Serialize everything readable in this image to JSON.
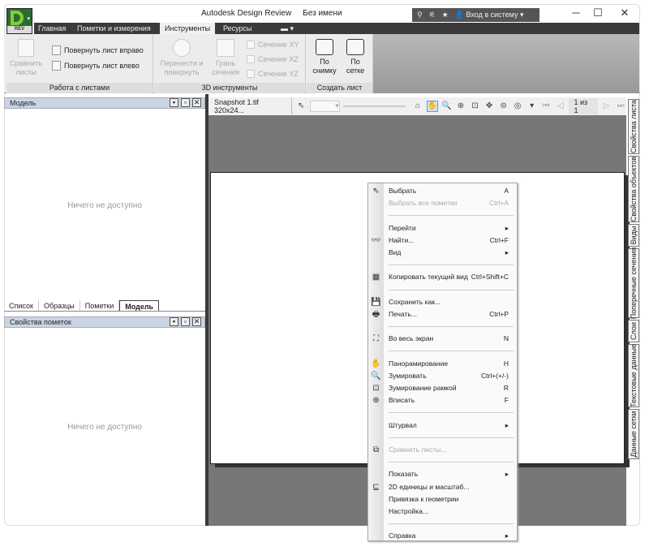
{
  "window": {
    "app_title": "Autodesk Design Review",
    "doc_title": "Без имени",
    "logo_text": "REV",
    "signin": "Вход в систему"
  },
  "ribbon_tabs": [
    {
      "label": "Главная"
    },
    {
      "label": "Пометки и измерения"
    },
    {
      "label": "Инструменты",
      "active": true
    },
    {
      "label": "Ресурсы"
    }
  ],
  "ribbon": {
    "sheets": {
      "label": "Работа с листами",
      "compare": "Сравнить листы",
      "rotate_right": "Повернуть лист вправо",
      "rotate_left": "Повернуть лист влево"
    },
    "tools3d": {
      "label": "3D инструменты",
      "move_rotate": "Перенести и повернуть",
      "section_face": "Грань сечения",
      "xy": "Сечение XY",
      "xz": "Сечение XZ",
      "yz": "Сечение YZ"
    },
    "create": {
      "label": "Создать лист",
      "by_snapshot": "По снимку",
      "by_grid": "По сетке"
    }
  },
  "left_panel": {
    "model_title": "Модель",
    "empty1": "Ничего не доступно",
    "tabs": [
      "Список",
      "Образцы",
      "Пометки",
      "Модель"
    ],
    "active_tab": "Модель",
    "markup_title": "Свойства пометок",
    "empty2": "Ничего не доступно"
  },
  "viewer": {
    "doc_tab": "Snapshot 1.tif 320x24...",
    "page": "1 из 1"
  },
  "right_tabs": [
    "Свойства листа",
    "Свойства объектов",
    "Виды",
    "Поперечные сечения",
    "Слои",
    "Текстовые данные",
    "Данные сетки"
  ],
  "context_menu": [
    {
      "label": "Выбрать",
      "shortcut": "A",
      "icon": "cursor-icon"
    },
    {
      "label": "Выбрать все пометки",
      "shortcut": "Ctrl+A",
      "disabled": true
    },
    {
      "sep": true
    },
    {
      "label": "Перейти",
      "submenu": true
    },
    {
      "label": "Найти...",
      "shortcut": "Ctrl+F",
      "icon": "binoculars-icon"
    },
    {
      "label": "Вид",
      "submenu": true
    },
    {
      "sep": true
    },
    {
      "label": "Копировать текущий вид",
      "shortcut": "Ctrl+Shift+C",
      "icon": "copy-view-icon"
    },
    {
      "sep": true
    },
    {
      "label": "Сохранить как...",
      "icon": "save-icon"
    },
    {
      "label": "Печать...",
      "shortcut": "Ctrl+P",
      "icon": "print-icon"
    },
    {
      "sep": true
    },
    {
      "label": "Во весь экран",
      "shortcut": "N",
      "icon": "fullscreen-icon"
    },
    {
      "sep": true
    },
    {
      "label": "Панорамирование",
      "shortcut": "H",
      "icon": "pan-icon"
    },
    {
      "label": "Зумировать",
      "shortcut": "Ctrl+(+/-)",
      "icon": "zoom-icon"
    },
    {
      "label": "Зумирование рамкой",
      "shortcut": "R",
      "icon": "zoom-window-icon"
    },
    {
      "label": "Вписать",
      "shortcut": "F",
      "icon": "fit-icon"
    },
    {
      "sep": true
    },
    {
      "label": "Штурвал",
      "submenu": true
    },
    {
      "sep": true
    },
    {
      "label": "Сравнить листы...",
      "disabled": true,
      "icon": "compare-icon"
    },
    {
      "sep": true
    },
    {
      "label": "Показать",
      "submenu": true
    },
    {
      "label": "2D единицы и масштаб...",
      "icon": "units-icon"
    },
    {
      "label": "Привязка к геометрии"
    },
    {
      "label": "Настройка..."
    },
    {
      "sep": true
    },
    {
      "label": "Справка",
      "submenu": true
    }
  ]
}
